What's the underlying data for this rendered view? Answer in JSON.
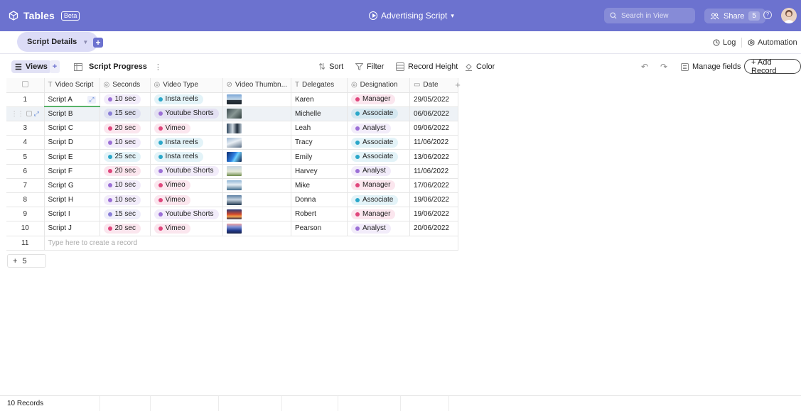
{
  "app": {
    "name": "Tables",
    "badge": "Beta",
    "doc_title": "Advertising Script",
    "doc_caret": "▾"
  },
  "search": {
    "placeholder": "Search in View"
  },
  "share": {
    "label": "Share",
    "count": "5"
  },
  "tabbar": {
    "tab_label": "Script Details",
    "log_label": "Log",
    "automation_label": "Automation"
  },
  "toolbar": {
    "views_label": "Views",
    "view_name": "Script Progress",
    "sort_label": "Sort",
    "filter_label": "Filter",
    "record_height_label": "Record Height",
    "color_label": "Color",
    "manage_fields_label": "Manage fields",
    "add_record_label": "+ Add Record"
  },
  "columns": [
    "Video Script",
    "Seconds",
    "Video Type",
    "Video Thumbn...",
    "Delegates",
    "Designation",
    "Date"
  ],
  "column_icons": [
    "text-icon",
    "number-icon",
    "select-icon",
    "attachment-icon",
    "text-icon",
    "select-icon",
    "date-icon"
  ],
  "rows": [
    {
      "n": "1",
      "script": "Script A",
      "seconds": "10 sec",
      "type": "Insta reels",
      "delegate": "Karen",
      "designation": "Manager",
      "date": "29/05/2022"
    },
    {
      "n": "2",
      "script": "Script B",
      "seconds": "15 sec",
      "type": "Youtube Shorts",
      "delegate": "Michelle",
      "designation": "Associate",
      "date": "06/06/2022"
    },
    {
      "n": "3",
      "script": "Script C",
      "seconds": "20 sec",
      "type": "Vimeo",
      "delegate": "Leah",
      "designation": "Analyst",
      "date": "09/06/2022"
    },
    {
      "n": "4",
      "script": "Script D",
      "seconds": "10 sec",
      "type": "Insta reels",
      "delegate": "Tracy",
      "designation": "Associate",
      "date": "11/06/2022"
    },
    {
      "n": "5",
      "script": "Script E",
      "seconds": "25 sec",
      "type": "Insta reels",
      "delegate": "Emily",
      "designation": "Associate",
      "date": "13/06/2022"
    },
    {
      "n": "6",
      "script": "Script F",
      "seconds": "20 sec",
      "type": "Youtube Shorts",
      "delegate": "Harvey",
      "designation": "Analyst",
      "date": "11/06/2022"
    },
    {
      "n": "7",
      "script": "Script G",
      "seconds": "10 sec",
      "type": "Vimeo",
      "delegate": "Mike",
      "designation": "Manager",
      "date": "17/06/2022"
    },
    {
      "n": "8",
      "script": "Script H",
      "seconds": "10 sec",
      "type": "Vimeo",
      "delegate": "Donna",
      "designation": "Associate",
      "date": "19/06/2022"
    },
    {
      "n": "9",
      "script": "Script I",
      "seconds": "15 sec",
      "type": "Youtube Shorts",
      "delegate": "Robert",
      "designation": "Manager",
      "date": "19/06/2022"
    },
    {
      "n": "10",
      "script": "Script J",
      "seconds": "20 sec",
      "type": "Vimeo",
      "delegate": "Pearson",
      "designation": "Analyst",
      "date": "20/06/2022"
    }
  ],
  "new_row": {
    "n": "11",
    "placeholder": "Type here to create a record"
  },
  "add_rows": {
    "plus": "+",
    "count": "5"
  },
  "status": {
    "records": "10 Records"
  },
  "colors": {
    "accent": "#6c72cf",
    "seconds": {
      "10 sec": "#9b6fd6",
      "15 sec": "#8a7fd8",
      "20 sec": "#e0467c",
      "25 sec": "#2aa7c9"
    },
    "type": {
      "Insta reels": "#2aa7c9",
      "Youtube Shorts": "#9b6fd6",
      "Vimeo": "#e0467c"
    },
    "designation": {
      "Manager": "#e0467c",
      "Associate": "#2aa7c9",
      "Analyst": "#9b6fd6"
    }
  }
}
